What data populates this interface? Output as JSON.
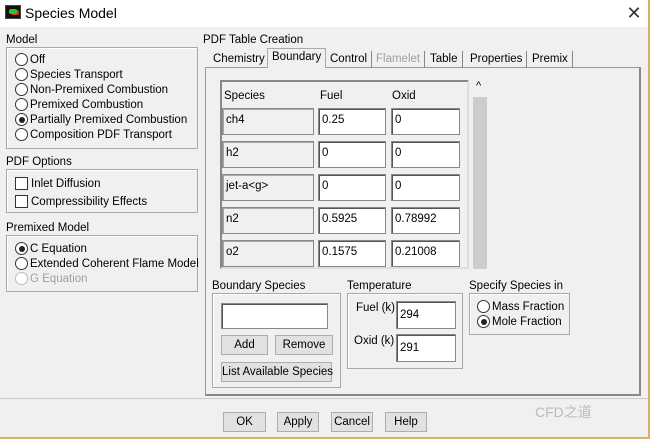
{
  "window": {
    "title": "Species Model",
    "close": "✕"
  },
  "model": {
    "label": "Model",
    "options": [
      {
        "label": "Off",
        "selected": false
      },
      {
        "label": "Species Transport",
        "selected": false
      },
      {
        "label": "Non-Premixed Combustion",
        "selected": false
      },
      {
        "label": "Premixed Combustion",
        "selected": false
      },
      {
        "label": "Partially Premixed Combustion",
        "selected": true
      },
      {
        "label": "Composition PDF Transport",
        "selected": false
      }
    ]
  },
  "pdf_options": {
    "label": "PDF Options",
    "items": [
      {
        "label": "Inlet Diffusion",
        "checked": false
      },
      {
        "label": "Compressibility Effects",
        "checked": false
      }
    ]
  },
  "premixed_model": {
    "label": "Premixed Model",
    "options": [
      {
        "label": "C Equation",
        "selected": true
      },
      {
        "label": "Extended Coherent Flame Model",
        "selected": false
      },
      {
        "label": "G Equation",
        "selected": false,
        "disabled": true
      }
    ]
  },
  "pdf_table": {
    "label": "PDF Table Creation",
    "tabs": [
      {
        "label": "Chemistry"
      },
      {
        "label": "Boundary",
        "active": true
      },
      {
        "label": "Control"
      },
      {
        "label": "Flamelet",
        "disabled": true
      },
      {
        "label": "Table"
      },
      {
        "label": "Properties"
      },
      {
        "label": "Premix"
      }
    ]
  },
  "boundary": {
    "headers": {
      "species": "Species",
      "fuel": "Fuel",
      "oxid": "Oxid"
    },
    "rows": [
      {
        "species": "ch4",
        "fuel": "0.25",
        "oxid": "0"
      },
      {
        "species": "h2",
        "fuel": "0",
        "oxid": "0"
      },
      {
        "species": "jet-a<g>",
        "fuel": "0",
        "oxid": "0"
      },
      {
        "species": "n2",
        "fuel": "0.5925",
        "oxid": "0.78992"
      },
      {
        "species": "o2",
        "fuel": "0.1575",
        "oxid": "0.21008"
      }
    ],
    "scroll_up": "^",
    "boundary_species": {
      "label": "Boundary Species",
      "value": "",
      "add": "Add",
      "remove": "Remove",
      "list": "List Available Species"
    },
    "temperature": {
      "label": "Temperature",
      "fuel_label": "Fuel (k)",
      "fuel_value": "294",
      "oxid_label": "Oxid (k)",
      "oxid_value": "291"
    },
    "specify": {
      "label": "Specify Species in",
      "options": [
        {
          "label": "Mass Fraction",
          "selected": false
        },
        {
          "label": "Mole Fraction",
          "selected": true
        }
      ]
    }
  },
  "buttons": {
    "ok": "OK",
    "apply": "Apply",
    "cancel": "Cancel",
    "help": "Help"
  },
  "watermark": "CFD之道"
}
